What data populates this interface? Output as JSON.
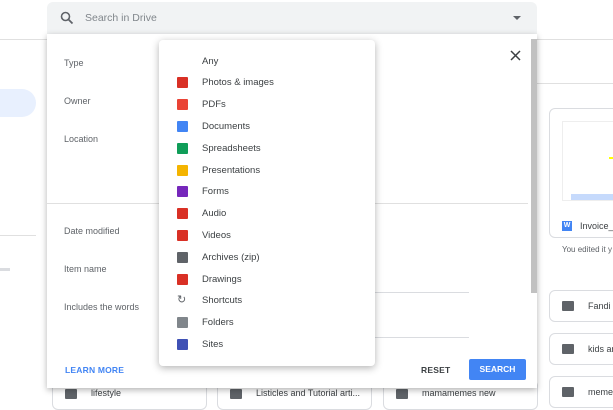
{
  "search": {
    "placeholder": "Search in Drive"
  },
  "filters": {
    "type_label": "Type",
    "owner_label": "Owner",
    "location_label": "Location",
    "date_modified_label": "Date modified",
    "item_name_label": "Item name",
    "includes_words_label": "Includes the words",
    "learn_more": "LEARN MORE",
    "reset": "RESET",
    "search": "SEARCH"
  },
  "type_menu": {
    "items": [
      {
        "label": "Any",
        "icon": "none",
        "color": ""
      },
      {
        "label": "Photos & images",
        "icon": "image-icon",
        "color": "#d93025"
      },
      {
        "label": "PDFs",
        "icon": "pdf-icon",
        "color": "#ea4335"
      },
      {
        "label": "Documents",
        "icon": "docs-icon",
        "color": "#4285f4"
      },
      {
        "label": "Spreadsheets",
        "icon": "sheets-icon",
        "color": "#0f9d58"
      },
      {
        "label": "Presentations",
        "icon": "slides-icon",
        "color": "#f4b400"
      },
      {
        "label": "Forms",
        "icon": "forms-icon",
        "color": "#7627bb"
      },
      {
        "label": "Audio",
        "icon": "audio-icon",
        "color": "#d93025"
      },
      {
        "label": "Videos",
        "icon": "video-icon",
        "color": "#d93025"
      },
      {
        "label": "Archives (zip)",
        "icon": "archive-icon",
        "color": "#5f6368"
      },
      {
        "label": "Drawings",
        "icon": "drawing-icon",
        "color": "#d93025"
      },
      {
        "label": "Shortcuts",
        "icon": "shortcut-icon",
        "color": "#5f6368"
      },
      {
        "label": "Folders",
        "icon": "folder-icon",
        "color": "#80868b"
      },
      {
        "label": "Sites",
        "icon": "sites-icon",
        "color": "#3f51b5"
      }
    ]
  },
  "background": {
    "file_card": {
      "badge": "W",
      "name": "Invoice_",
      "subtitle": "You edited it y"
    },
    "folders": [
      "Fandi u",
      "kids ar",
      "memes"
    ],
    "bottom_row": [
      "lifestyle",
      "Listicles and Tutorial arti...",
      "mamamemes new"
    ]
  }
}
